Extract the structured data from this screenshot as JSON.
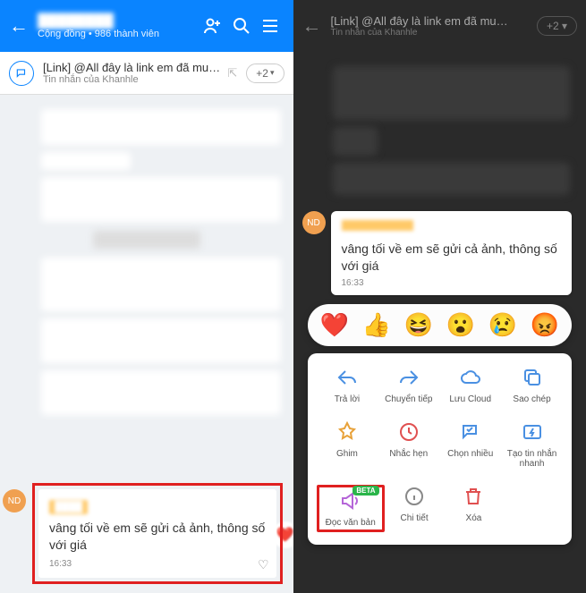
{
  "left": {
    "header": {
      "community_label": "Cộng đồng",
      "members": "986 thành viên"
    },
    "pinned": {
      "title": "[Link] @All đây là link em đã mu…",
      "subtitle": "Tin nhắn của Khanhle",
      "badge": "+2"
    },
    "message": {
      "avatar": "ND",
      "text": "vâng tối về em sẽ gửi cả ảnh, thông số với giá",
      "time": "16:33"
    }
  },
  "right": {
    "header": {
      "title": "[Link] @All đây là link em đã mu…",
      "subtitle": "Tin nhắn của Khanhle",
      "badge": "+2"
    },
    "message": {
      "avatar": "ND",
      "text": "vâng tối về em sẽ gửi cả ảnh, thông số với giá",
      "time": "16:33"
    },
    "reactions": [
      "❤️",
      "👍",
      "😆",
      "😮",
      "😢",
      "😡"
    ],
    "menu": {
      "row1": [
        {
          "label": "Trả lời"
        },
        {
          "label": "Chuyển tiếp"
        },
        {
          "label": "Lưu Cloud"
        },
        {
          "label": "Sao chép"
        }
      ],
      "row2": [
        {
          "label": "Ghim"
        },
        {
          "label": "Nhắc hẹn"
        },
        {
          "label": "Chọn nhiều"
        },
        {
          "label": "Tạo tin nhắn nhanh"
        }
      ],
      "row3": [
        {
          "label": "Đọc văn bản",
          "badge": "BETA"
        },
        {
          "label": "Chi tiết"
        },
        {
          "label": "Xóa"
        }
      ]
    }
  }
}
